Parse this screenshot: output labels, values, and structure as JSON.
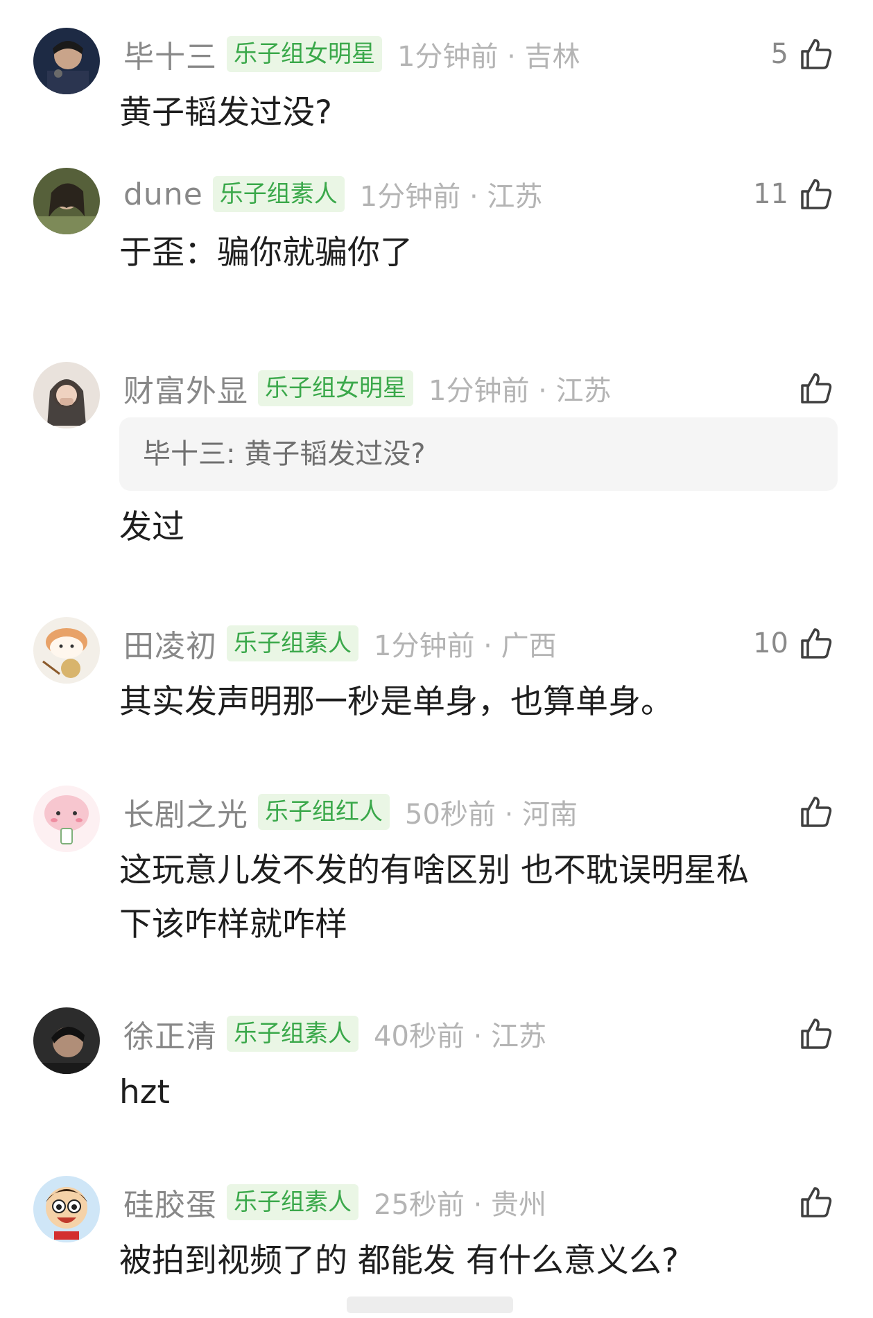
{
  "comments": [
    {
      "user": "毕十三",
      "badge": "乐子组女明星",
      "meta": "1分钟前 · 吉林",
      "likes": "5",
      "text": "黄子韬发过没?"
    },
    {
      "user": "dune",
      "badge": "乐子组素人",
      "meta": "1分钟前 · 江苏",
      "likes": "11",
      "text": "于歪：骗你就骗你了"
    },
    {
      "user": "财富外显",
      "badge": "乐子组女明星",
      "meta": "1分钟前 · 江苏",
      "likes": "",
      "quote": "毕十三: 黄子韬发过没?",
      "text": "发过"
    },
    {
      "user": "田凌初",
      "badge": "乐子组素人",
      "meta": "1分钟前 · 广西",
      "likes": "10",
      "text": "其实发声明那一秒是单身，也算单身。"
    },
    {
      "user": "长剧之光",
      "badge": "乐子组红人",
      "meta": "50秒前 · 河南",
      "likes": "",
      "text_line1": "这玩意儿发不发的有啥区别 也不耽误明星私",
      "text_line2": "下该咋样就咋样"
    },
    {
      "user": "徐正清",
      "badge": "乐子组素人",
      "meta": "40秒前 · 江苏",
      "likes": "",
      "text": "hzt"
    },
    {
      "user": "硅胶蛋",
      "badge": "乐子组素人",
      "meta": "25秒前 · 贵州",
      "likes": "",
      "text": "被拍到视频了的 都能发 有什么意义么?"
    }
  ],
  "colors": {
    "badge_text": "#3aa84a",
    "badge_bg": "#eaf6e5",
    "username": "#888888",
    "meta": "#b4b4b4"
  },
  "icons": {
    "like": "thumbs-up-icon"
  }
}
